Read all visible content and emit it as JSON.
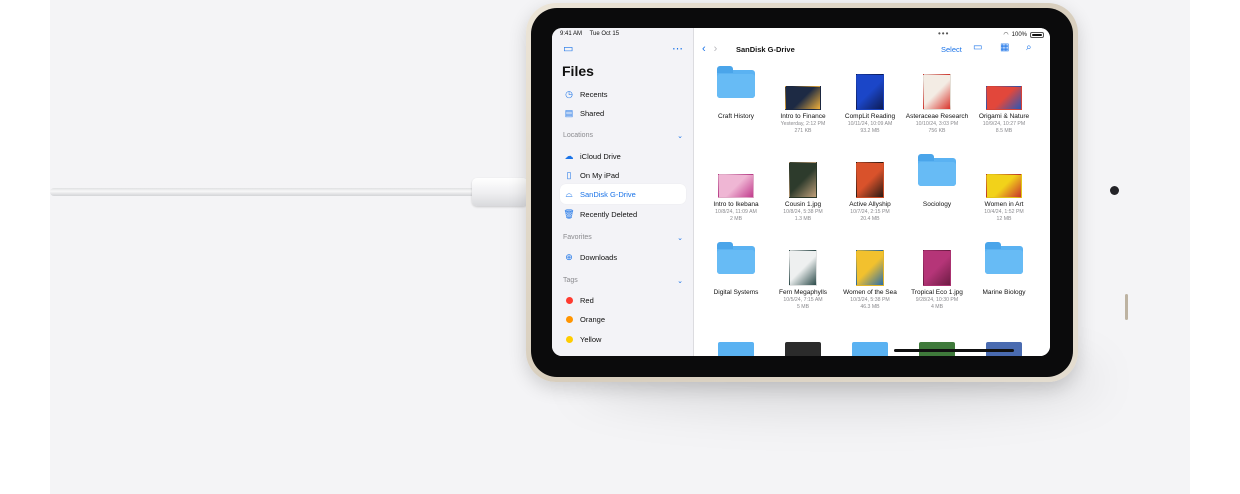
{
  "status_bar": {
    "time": "9:41 AM",
    "date": "Tue Oct 15",
    "battery": "100%"
  },
  "sidebar": {
    "title": "Files",
    "top_items": [
      {
        "label": "Recents",
        "icon": "clock-icon"
      },
      {
        "label": "Shared",
        "icon": "shared-folder-icon"
      }
    ],
    "locations": {
      "heading": "Locations",
      "items": [
        {
          "label": "iCloud Drive",
          "icon": "cloud-icon"
        },
        {
          "label": "On My iPad",
          "icon": "ipad-icon"
        },
        {
          "label": "SanDisk G-Drive",
          "icon": "external-drive-icon",
          "active": true
        },
        {
          "label": "Recently Deleted",
          "icon": "trash-icon"
        }
      ]
    },
    "favorites": {
      "heading": "Favorites",
      "items": [
        {
          "label": "Downloads",
          "icon": "download-icon"
        }
      ]
    },
    "tags": {
      "heading": "Tags",
      "items": [
        {
          "label": "Red",
          "color": "#ff3b30"
        },
        {
          "label": "Orange",
          "color": "#ff9500"
        },
        {
          "label": "Yellow",
          "color": "#ffcc00"
        }
      ]
    }
  },
  "toolbar": {
    "title": "SanDisk G-Drive",
    "select_label": "Select"
  },
  "files": [
    {
      "name": "Craft History",
      "kind": "folder",
      "meta": []
    },
    {
      "name": "Intro to Finance",
      "kind": "image",
      "meta": [
        "Yesterday, 2:12 PM",
        "271 KB"
      ],
      "colors": [
        "#1d2a44",
        "#f2b13a"
      ]
    },
    {
      "name": "CompLit Reading",
      "kind": "image",
      "meta": [
        "10/11/24, 10:09 AM",
        "93.2 MB"
      ],
      "colors": [
        "#1b46c8",
        "#0d1b55"
      ]
    },
    {
      "name": "Asteraceae Research",
      "kind": "image",
      "meta": [
        "10/10/24, 3:03 PM",
        "756 KB"
      ],
      "colors": [
        "#f3ece4",
        "#d9342b"
      ]
    },
    {
      "name": "Origami & Nature",
      "kind": "image",
      "meta": [
        "10/9/24, 10:27 PM",
        "8.5 MB"
      ],
      "colors": [
        "#e2473b",
        "#2a57b8"
      ]
    },
    {
      "name": "Intro to Ikebana",
      "kind": "image",
      "meta": [
        "10/8/24, 11:09 AM",
        "2 MB"
      ],
      "colors": [
        "#efb6d4",
        "#c13c8d"
      ]
    },
    {
      "name": "Cousin 1.jpg",
      "kind": "image",
      "meta": [
        "10/8/24, 5:38 PM",
        "1.3 MB"
      ],
      "colors": [
        "#2d3b2c",
        "#c0a07a"
      ]
    },
    {
      "name": "Active Allyship",
      "kind": "image",
      "meta": [
        "10/7/24, 2:15 PM",
        "20.4 MB"
      ],
      "colors": [
        "#d9522b",
        "#2b1a14"
      ]
    },
    {
      "name": "Sociology",
      "kind": "folder",
      "meta": []
    },
    {
      "name": "Women in Art",
      "kind": "image",
      "meta": [
        "10/4/24, 1:52 PM",
        "12 MB"
      ],
      "colors": [
        "#f2d21a",
        "#c8342b"
      ]
    },
    {
      "name": "Digital Systems",
      "kind": "folder",
      "meta": []
    },
    {
      "name": "Fern Megaphylls",
      "kind": "image",
      "meta": [
        "10/5/24, 7:15 AM",
        "5 MB"
      ],
      "colors": [
        "#eef0f0",
        "#2c4b4a"
      ]
    },
    {
      "name": "Women of the Sea",
      "kind": "image",
      "meta": [
        "10/3/24, 5:38 PM",
        "46.3 MB"
      ],
      "colors": [
        "#f2c12e",
        "#2b6ea8"
      ]
    },
    {
      "name": "Tropical Eco 1.jpg",
      "kind": "image",
      "meta": [
        "9/28/24, 10:30 PM",
        "4 MB"
      ],
      "colors": [
        "#b53578",
        "#6e1c44"
      ]
    },
    {
      "name": "Marine Biology",
      "kind": "folder",
      "meta": []
    }
  ],
  "partial_row_colors": [
    "#5ab2f2",
    "#2b2b2b",
    "#5ab2f2",
    "#3f7a3b",
    "#4a6bb0"
  ]
}
